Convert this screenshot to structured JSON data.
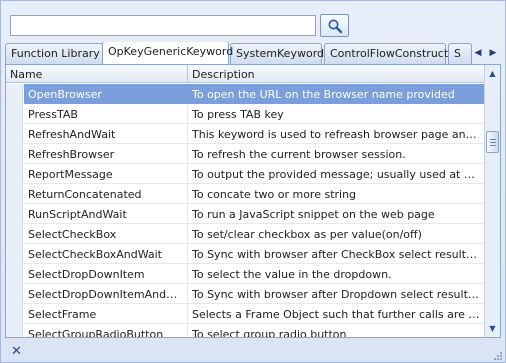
{
  "search": {
    "value": "",
    "placeholder": ""
  },
  "tabs": [
    {
      "label": "Function Library",
      "active": false
    },
    {
      "label": "OpKeyGenericKeyword",
      "active": true
    },
    {
      "label": "SystemKeyword",
      "active": false
    },
    {
      "label": "ControlFlowConstruct",
      "active": false
    },
    {
      "label": "S",
      "active": false
    }
  ],
  "grid": {
    "columns": {
      "name": "Name",
      "description": "Description"
    },
    "rows": [
      {
        "name": "OpenBrowser",
        "description": "To open the URL on the Browser name provided",
        "selected": true
      },
      {
        "name": "PressTAB",
        "description": "To press TAB key"
      },
      {
        "name": "RefreshAndWait",
        "description": "This keyword is used to refreash browser page and waits..."
      },
      {
        "name": "RefreshBrowser",
        "description": "To refresh the current browser session."
      },
      {
        "name": "ReportMessage",
        "description": "To output the provided message; usually used at end of ..."
      },
      {
        "name": "ReturnConcatenated",
        "description": "To concate two or more string"
      },
      {
        "name": "RunScriptAndWait",
        "description": "To run a JavaScript snippet on the web page"
      },
      {
        "name": "SelectCheckBox",
        "description": "To set/clear checkbox as per value(on/off)"
      },
      {
        "name": "SelectCheckBoxAndWait",
        "description": "To Sync with browser after CheckBox select results in br..."
      },
      {
        "name": "SelectDropDownItem",
        "description": "To select the value in the dropdown."
      },
      {
        "name": "SelectDropDownItemAndWait",
        "description": "To Sync with browser after Dropdown select results in br..."
      },
      {
        "name": "SelectFrame",
        "description": "Selects a Frame Object such that further calls are made i..."
      },
      {
        "name": "SelectGroupRadioButton",
        "description": "To select group radio button"
      }
    ]
  },
  "bottom": {
    "close_glyph": "✕"
  },
  "colors": {
    "selection": "#7a9fdc",
    "accent": "#2a4c86"
  }
}
